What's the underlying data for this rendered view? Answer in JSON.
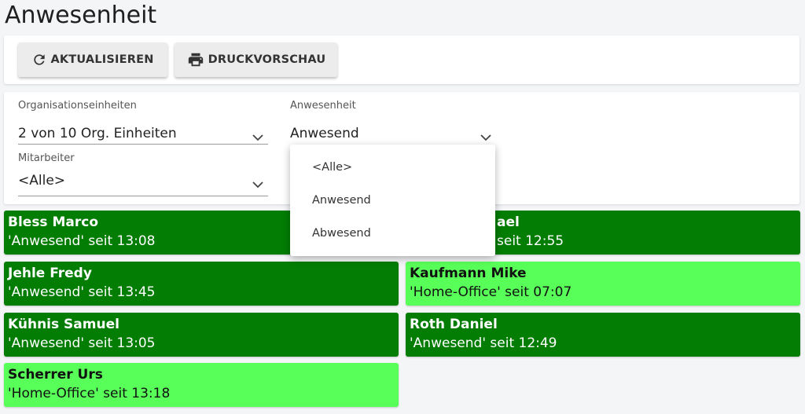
{
  "page": {
    "title": "Anwesenheit"
  },
  "toolbar": {
    "refresh_label": "AKTUALISIEREN",
    "print_label": "DRUCKVORSCHAU",
    "refresh_icon": "refresh-icon",
    "print_icon": "printer-icon"
  },
  "filters": {
    "org": {
      "label": "Organisationseinheiten",
      "value": "2 von 10 Org. Einheiten"
    },
    "anwesenheit": {
      "label": "Anwesenheit",
      "value": "Anwesend"
    },
    "mitarbeiter": {
      "label": "Mitarbeiter",
      "value": "<Alle>"
    }
  },
  "dropdown": {
    "options": [
      "<Alle>",
      "Anwesend",
      "Abwesend"
    ]
  },
  "colors": {
    "present": "#037d04",
    "home_office": "#59ff59"
  },
  "employees": [
    {
      "name": "Bless Marco",
      "status": "'Anwesend' seit 13:08",
      "type": "present"
    },
    {
      "name": "ael",
      "status": "seit 12:55",
      "type": "present"
    },
    {
      "name": "Jehle Fredy",
      "status": "'Anwesend' seit 13:45",
      "type": "present"
    },
    {
      "name": "Kaufmann Mike",
      "status": "'Home-Office' seit 07:07",
      "type": "home"
    },
    {
      "name": "Kühnis Samuel",
      "status": "'Anwesend' seit 13:05",
      "type": "present"
    },
    {
      "name": "Roth Daniel",
      "status": "'Anwesend' seit 12:49",
      "type": "present"
    },
    {
      "name": "Scherrer Urs",
      "status": "'Home-Office' seit 13:18",
      "type": "home"
    }
  ]
}
